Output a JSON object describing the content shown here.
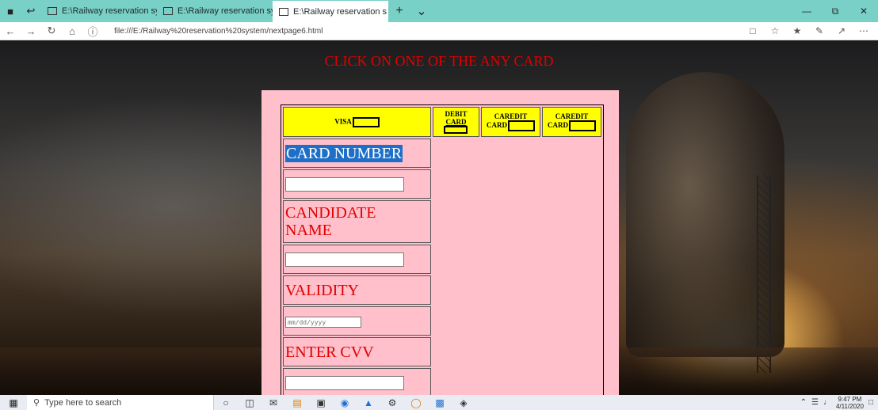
{
  "browser": {
    "tabs": [
      {
        "label": "E:\\Railway reservation syste"
      },
      {
        "label": "E:\\Railway reservation syste"
      },
      {
        "label": "E:\\Railway reservation s"
      }
    ],
    "url": "file:///E:/Railway%20reservation%20system/nextpage6.html"
  },
  "page": {
    "heading": "CLICK ON ONE OF THE ANY CARD",
    "cards": {
      "visa": "VISA",
      "debit_line1": "DEBIT",
      "debit_line2": "CARD",
      "credit1_line1": "CAREDIT",
      "credit1_line2": "CARD",
      "credit2_line1": "CAREDIT",
      "credit2_line2": "CARD"
    },
    "form": {
      "card_number_label": "CARD NUMBER",
      "candidate_name_label_1": "CANDIDATE",
      "candidate_name_label_2": "NAME",
      "validity_label": "VALIDITY",
      "validity_placeholder": "mm/dd/yyyy",
      "cvv_label": "ENTER CVV"
    }
  },
  "taskbar": {
    "search_placeholder": "Type here to search",
    "time": "9:47 PM",
    "date": "4/11/2020"
  }
}
